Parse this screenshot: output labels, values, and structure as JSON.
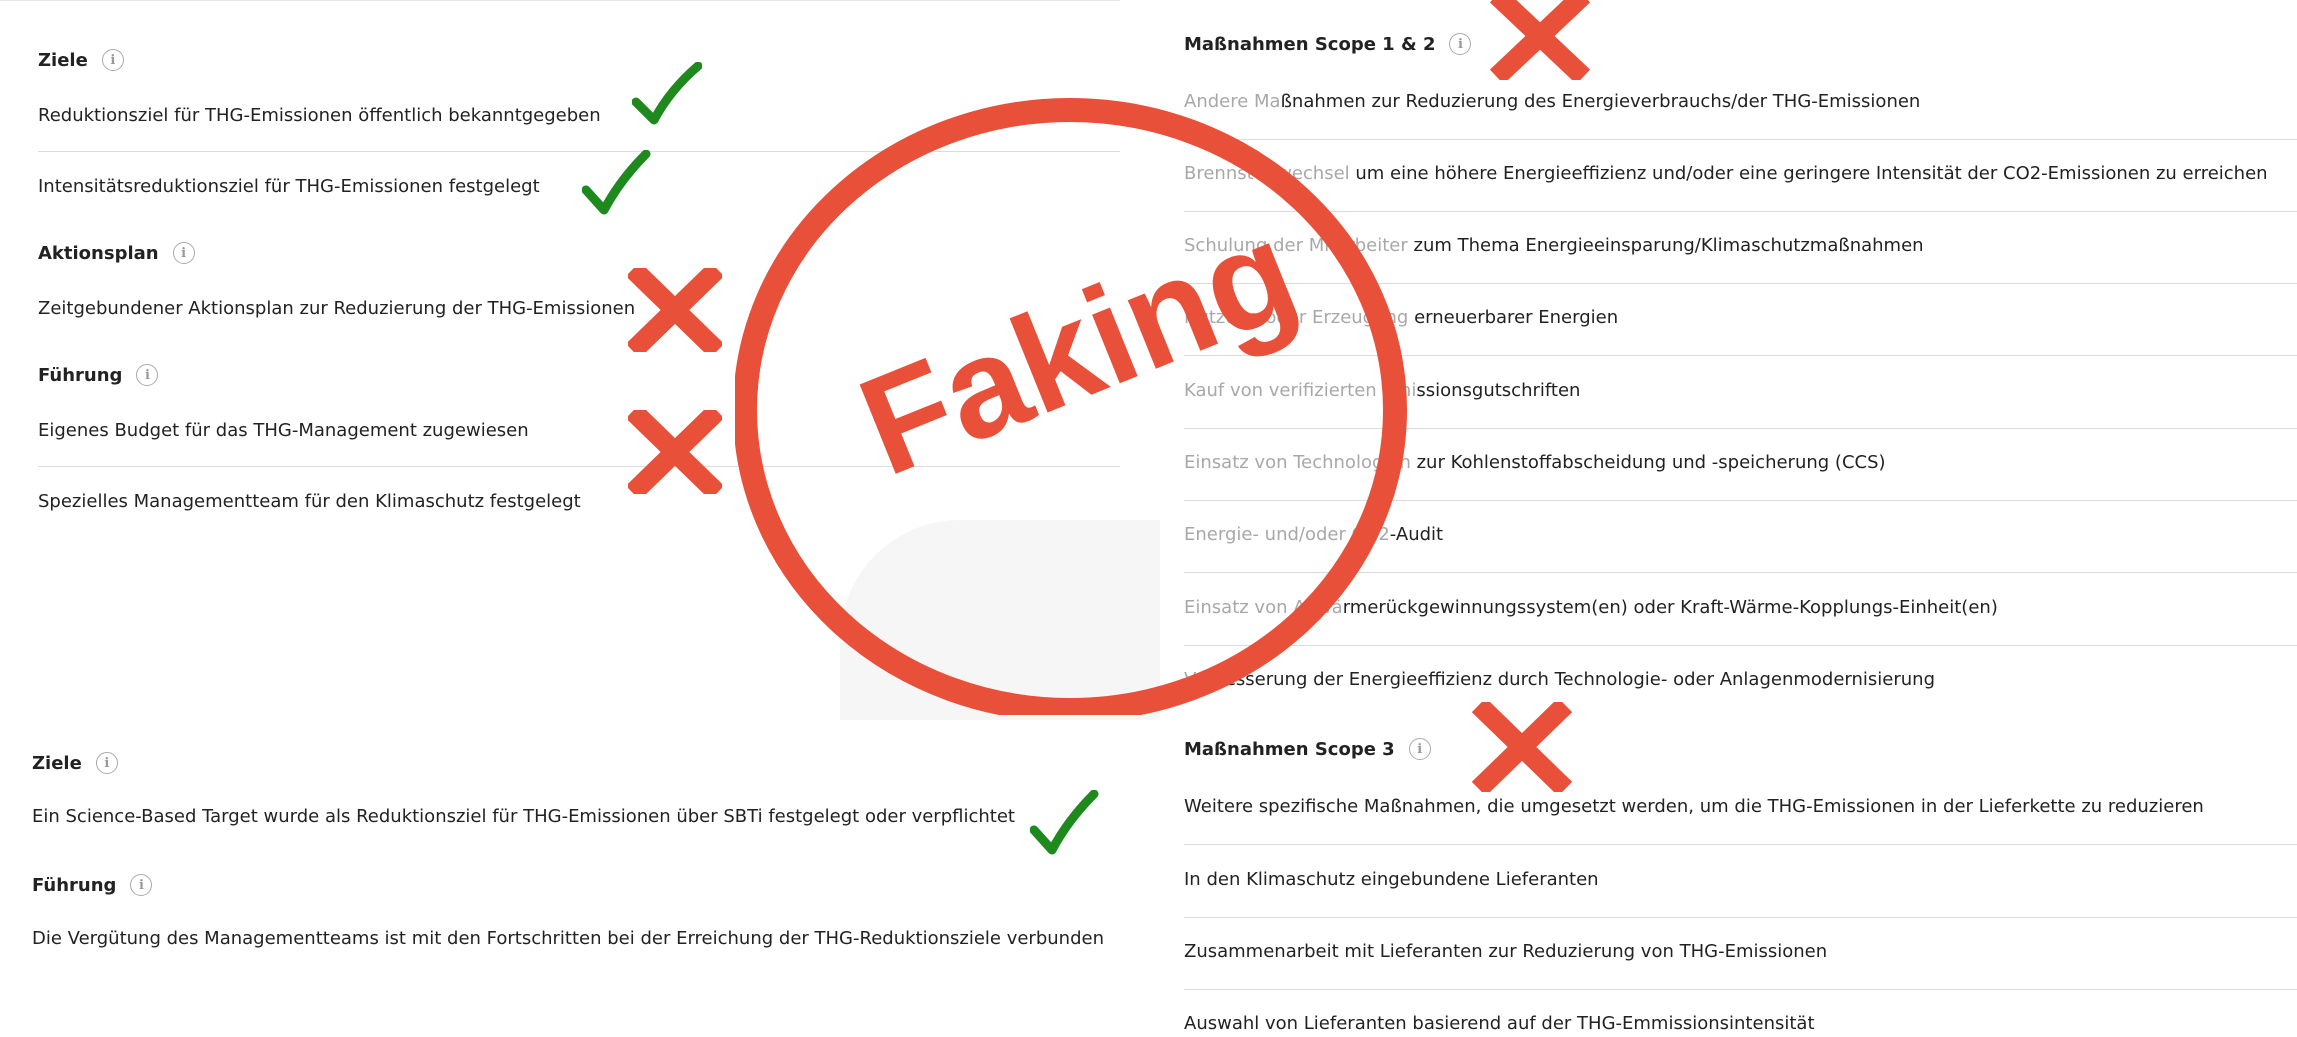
{
  "top_left": {
    "ziele_heading": "Ziele",
    "ziele_rows": [
      "Reduktionsziel für THG-Emissionen öffentlich bekanntgegeben",
      "Intensitätsreduktionsziel für THG-Emissionen festgelegt"
    ],
    "aktionsplan_heading": "Aktionsplan",
    "aktionsplan_rows": [
      "Zeitgebundener Aktionsplan zur Reduzierung der THG-Emissionen"
    ],
    "fuehrung_heading": "Führung",
    "fuehrung_rows": [
      "Eigenes Budget für das THG-Management zugewiesen",
      "Spezielles Managementteam für den Klimaschutz festgelegt"
    ]
  },
  "bottom_left": {
    "ziele_heading": "Ziele",
    "ziele_rows": [
      "Ein Science-Based Target wurde als Reduktionsziel für THG-Emissionen über SBTi festgelegt oder verpflichtet"
    ],
    "fuehrung_heading": "Führung",
    "fuehrung_rows": [
      "Die Vergütung des Managementteams ist mit den Fortschritten bei der Erreichung der THG-Reduktionsziele verbunden"
    ]
  },
  "right": {
    "scope12_heading": "Maßnahmen Scope 1 & 2",
    "scope12_rows": [
      {
        "faded": "Andere Ma",
        "text": "ßnahmen zur Reduzierung des Energieverbrauchs/der THG-Emissionen"
      },
      {
        "faded": "Brennstoffwechsel ",
        "text": "um eine höhere Energieeffizienz und/oder eine geringere Intensität der CO2-Emissionen zu erreichen"
      },
      {
        "faded": "Schulung der Mitarbeiter ",
        "text": "zum Thema Energieeinsparung/Klimaschutzmaßnahmen"
      },
      {
        "faded": "Nutzung oder Erzeugung ",
        "text": "erneuerbarer Energien"
      },
      {
        "faded": "Kauf von verifizierten Emi",
        "text": "ssionsgutschriften"
      },
      {
        "faded": "Einsatz von Technologien ",
        "text": "zur Kohlenstoffabscheidung und -speicherung (CCS)"
      },
      {
        "faded": "Energie- und/oder CO2",
        "text": "-Audit"
      },
      {
        "faded": "Einsatz von Abwä",
        "text": "rmerückgewinnungssystem(en) oder Kraft-Wärme-Kopplungs-Einheit(en)"
      },
      {
        "faded": "Verb",
        "text": "esserung der Energieeffizienz durch Technologie- oder Anlagenmodernisierung"
      }
    ],
    "scope3_heading": "Maßnahmen Scope 3",
    "scope3_rows": [
      "Weitere spezifische Maßnahmen, die umgesetzt werden, um die THG-Emissionen in der Lieferkette zu reduzieren",
      "In den Klimaschutz eingebundene Lieferanten",
      "Zusammenarbeit mit Lieferanten zur Reduzierung von THG-Emissionen",
      "Auswahl von Lieferanten basierend auf der THG-Emmissionsintensität"
    ]
  },
  "stamp": {
    "text": "Faking",
    "color": "#e8503a"
  },
  "marks": {
    "check_color": "#1e8a1e",
    "cross_color": "#e8503a",
    "info_glyph": "i"
  },
  "icons": [
    "info-icon",
    "check-mark-icon",
    "cross-mark-icon"
  ]
}
